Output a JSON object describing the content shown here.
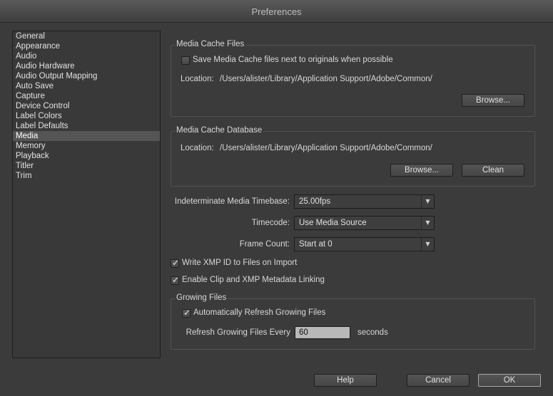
{
  "window": {
    "title": "Preferences"
  },
  "sidebar": {
    "items": [
      {
        "label": "General"
      },
      {
        "label": "Appearance"
      },
      {
        "label": "Audio"
      },
      {
        "label": "Audio Hardware"
      },
      {
        "label": "Audio Output Mapping"
      },
      {
        "label": "Auto Save"
      },
      {
        "label": "Capture"
      },
      {
        "label": "Device Control"
      },
      {
        "label": "Label Colors"
      },
      {
        "label": "Label Defaults"
      },
      {
        "label": "Media",
        "selected": true
      },
      {
        "label": "Memory"
      },
      {
        "label": "Playback"
      },
      {
        "label": "Titler"
      },
      {
        "label": "Trim"
      }
    ]
  },
  "media_cache_files": {
    "title": "Media Cache Files",
    "save_next_to_originals": {
      "label": "Save Media Cache files next to originals when possible",
      "checked": false
    },
    "location_label": "Location:",
    "location_value": "/Users/alister/Library/Application Support/Adobe/Common/",
    "browse_label": "Browse..."
  },
  "media_cache_database": {
    "title": "Media Cache Database",
    "location_label": "Location:",
    "location_value": "/Users/alister/Library/Application Support/Adobe/Common/",
    "browse_label": "Browse...",
    "clean_label": "Clean"
  },
  "settings": {
    "timebase": {
      "label": "Indeterminate Media Timebase:",
      "value": "25.00fps"
    },
    "timecode": {
      "label": "Timecode:",
      "value": "Use Media Source"
    },
    "frame_count": {
      "label": "Frame Count:",
      "value": "Start at 0"
    },
    "write_xmp": {
      "label": "Write XMP ID to Files on Import",
      "checked": true
    },
    "enable_linking": {
      "label": "Enable Clip and XMP Metadata Linking",
      "checked": true
    }
  },
  "growing_files": {
    "title": "Growing Files",
    "auto_refresh": {
      "label": "Automatically Refresh Growing Files",
      "checked": true
    },
    "refresh_every_label": "Refresh Growing Files Every",
    "refresh_every_value": "60",
    "seconds_label": "seconds"
  },
  "footer": {
    "help_label": "Help",
    "cancel_label": "Cancel",
    "ok_label": "OK"
  },
  "icons": {
    "check": "checkmark-icon",
    "dropdown": "chevron-down-icon"
  }
}
